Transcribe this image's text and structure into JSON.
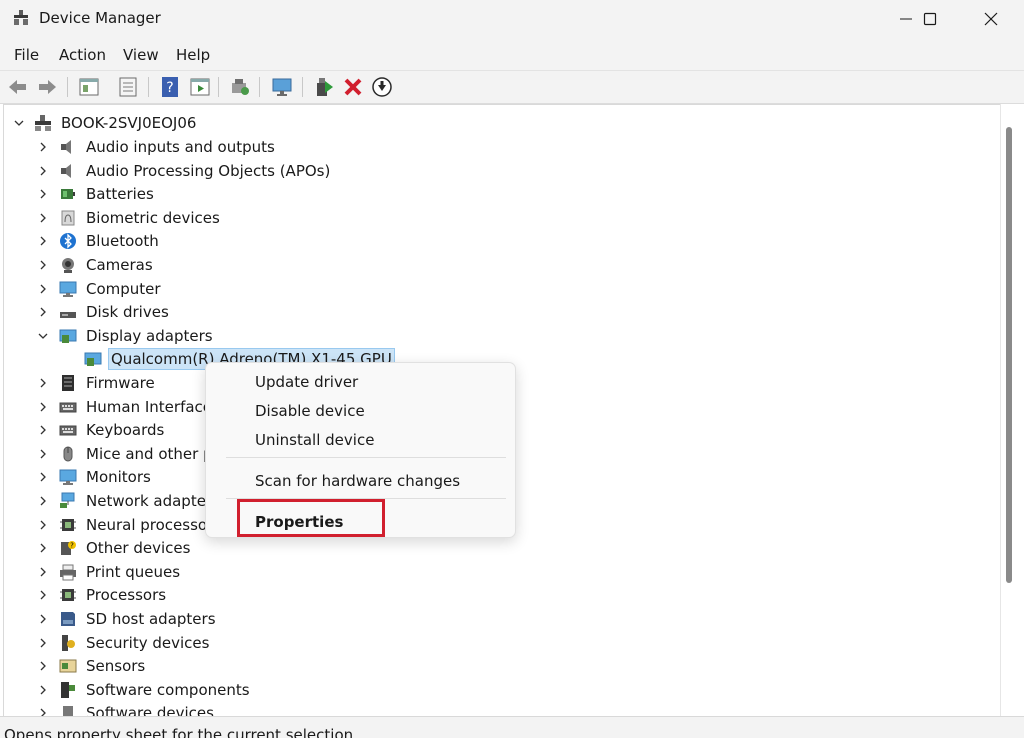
{
  "window": {
    "title": "Device Manager"
  },
  "menubar": {
    "items": [
      "File",
      "Action",
      "View",
      "Help"
    ]
  },
  "toolbar": {
    "buttons": [
      "back-icon",
      "forward-icon",
      "properties-pane-icon",
      "help-document-icon",
      "help-icon",
      "show-hidden-icon",
      "scan-hardware-icon",
      "monitor-icon",
      "update-driver-icon",
      "uninstall-icon",
      "download-icon"
    ]
  },
  "tree": {
    "root": "BOOK-2SVJ0EOJ06",
    "items": [
      {
        "label": "Audio inputs and outputs",
        "icon": "speaker-icon"
      },
      {
        "label": "Audio Processing Objects (APOs)",
        "icon": "speaker-icon"
      },
      {
        "label": "Batteries",
        "icon": "battery-icon"
      },
      {
        "label": "Biometric devices",
        "icon": "fingerprint-icon"
      },
      {
        "label": "Bluetooth",
        "icon": "bluetooth-icon"
      },
      {
        "label": "Cameras",
        "icon": "camera-icon"
      },
      {
        "label": "Computer",
        "icon": "computer-icon"
      },
      {
        "label": "Disk drives",
        "icon": "disk-drive-icon"
      },
      {
        "label": "Display adapters",
        "icon": "display-adapter-icon"
      },
      {
        "label": "Qualcomm(R) Adreno(TM) X1-45 GPU",
        "icon": "display-adapter-icon"
      },
      {
        "label": "Firmware",
        "icon": "firmware-icon"
      },
      {
        "label": "Human Interface I",
        "icon": "keyboard-icon"
      },
      {
        "label": "Keyboards",
        "icon": "keyboard-icon"
      },
      {
        "label": "Mice and other po",
        "icon": "mouse-icon"
      },
      {
        "label": "Monitors",
        "icon": "monitor-icon"
      },
      {
        "label": "Network adapters",
        "icon": "network-icon"
      },
      {
        "label": "Neural processors",
        "icon": "chip-icon"
      },
      {
        "label": "Other devices",
        "icon": "unknown-device-icon"
      },
      {
        "label": "Print queues",
        "icon": "printer-icon"
      },
      {
        "label": "Processors",
        "icon": "chip-icon"
      },
      {
        "label": "SD host adapters",
        "icon": "sd-card-icon"
      },
      {
        "label": "Security devices",
        "icon": "security-icon"
      },
      {
        "label": "Sensors",
        "icon": "sensor-icon"
      },
      {
        "label": "Software components",
        "icon": "software-component-icon"
      },
      {
        "label": "Software devices",
        "icon": "software-device-icon"
      }
    ]
  },
  "context_menu": {
    "items": [
      "Update driver",
      "Disable device",
      "Uninstall device",
      "Scan for hardware changes",
      "Properties"
    ]
  },
  "status": {
    "text": "Opens property sheet for the current selection."
  },
  "colors": {
    "highlight_border": "#d11f2e",
    "selection": "#cce4f7",
    "chrome": "#f3f3f3"
  }
}
